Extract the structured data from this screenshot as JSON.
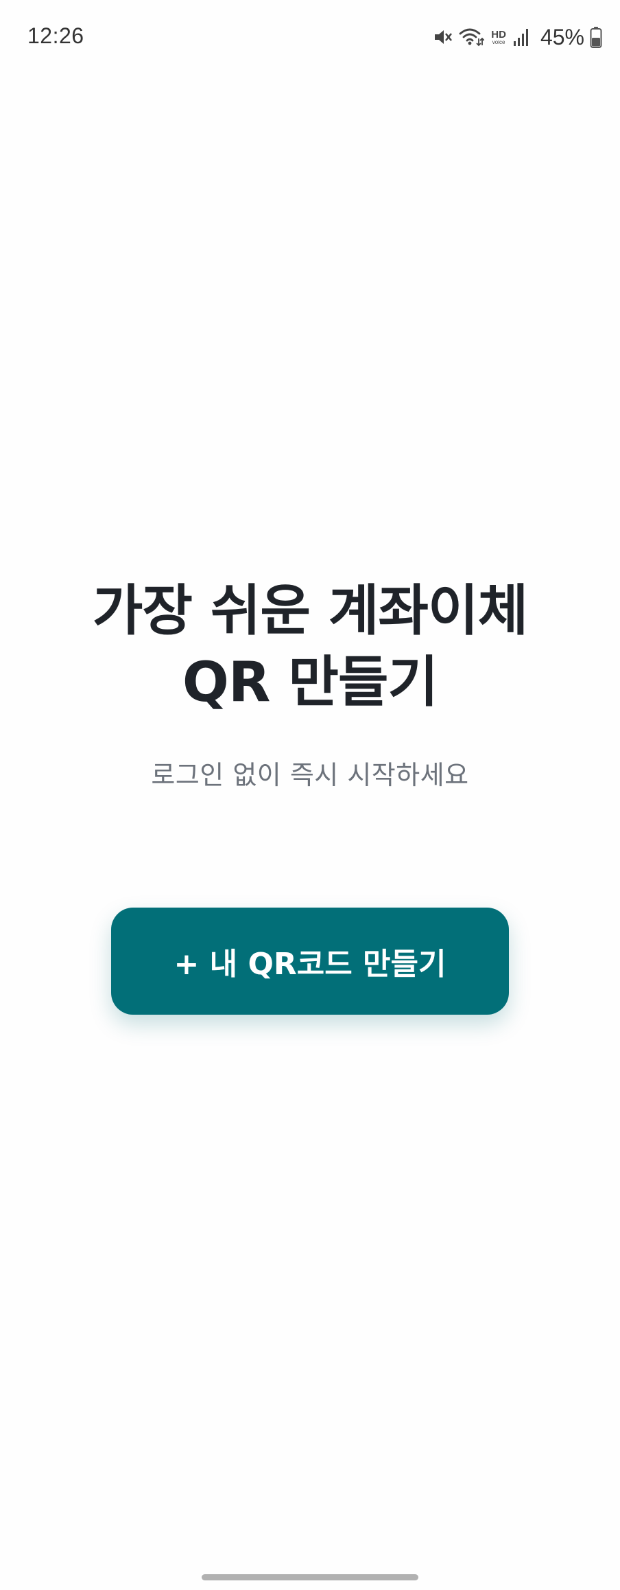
{
  "status_bar": {
    "time": "12:26",
    "hd_label": "HD",
    "hd_sublabel": "voice",
    "battery_percent": "45%",
    "icons": [
      "mute-icon",
      "wifi-icon",
      "hd-voice-icon",
      "signal-icon",
      "battery-icon"
    ]
  },
  "hero": {
    "title_line1": "가장 쉬운 계좌이체",
    "title_line2": "QR 만들기",
    "subtitle": "로그인 없이 즉시 시작하세요"
  },
  "cta": {
    "label": "+ 내 QR코드 만들기",
    "color": "#026f78"
  }
}
